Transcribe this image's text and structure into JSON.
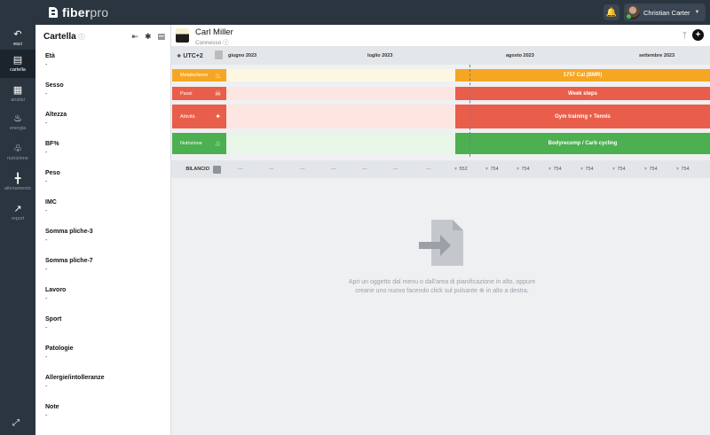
{
  "app": {
    "logo_main": "fiber",
    "logo_sub": "pro"
  },
  "user": {
    "name": "Christian Carter"
  },
  "nav": [
    {
      "label": "esci",
      "icon": "back-arrow-icon"
    },
    {
      "label": "cartella",
      "icon": "clipboard-icon"
    },
    {
      "label": "analisi",
      "icon": "chart-doc-icon"
    },
    {
      "label": "energia",
      "icon": "flame-icon"
    },
    {
      "label": "nutrizione",
      "icon": "cutlery-icon"
    },
    {
      "label": "allenamento",
      "icon": "dumbbell-icon"
    },
    {
      "label": "report",
      "icon": "line-chart-icon"
    }
  ],
  "panel": {
    "title": "Cartella",
    "fields": [
      {
        "label": "Età",
        "value": "-"
      },
      {
        "label": "Sesso",
        "value": "-"
      },
      {
        "label": "Altezza",
        "value": "-"
      },
      {
        "label": "BF%",
        "value": "-"
      },
      {
        "label": "Peso",
        "value": "-"
      },
      {
        "label": "IMC",
        "value": "-"
      },
      {
        "label": "Somma pliche-3",
        "value": "-"
      },
      {
        "label": "Somma pliche-7",
        "value": "-"
      },
      {
        "label": "Lavoro",
        "value": "-"
      },
      {
        "label": "Sport",
        "value": "-"
      },
      {
        "label": "Patologie",
        "value": "-"
      },
      {
        "label": "Allergie/intolleranze",
        "value": "-"
      },
      {
        "label": "Note",
        "value": "-"
      }
    ]
  },
  "patient": {
    "name": "Carl Miller",
    "status": "Connesso"
  },
  "timeline": {
    "timezone": "UTC+2",
    "months": [
      "giugno 2023",
      "luglio 2023",
      "agosto 2023",
      "settembre 2023"
    ],
    "rows": [
      {
        "label": "Metabolismo",
        "bar": "1757 Cal (BMR)",
        "color": "#f5a623",
        "light": "#fdf7e2"
      },
      {
        "label": "Passi",
        "bar": "Week steps",
        "color": "#e95e4a",
        "light": "#fde5e1"
      },
      {
        "label": "Attività",
        "bar": "Gym training + Tennis",
        "color": "#e95e4a",
        "light": "#fde5e1"
      },
      {
        "label": "Nutrizione",
        "bar": "Bodyrecomp / Carb cycling",
        "color": "#4caf50",
        "light": "#e8f6e8"
      }
    ],
    "bilancio": {
      "label": "BILANCIO",
      "empty": [
        "---",
        "---",
        "---",
        "---",
        "---",
        "---",
        "---"
      ],
      "values": [
        "552",
        "754",
        "754",
        "754",
        "754",
        "754",
        "754",
        "754"
      ]
    }
  },
  "empty_state": {
    "line1": "Apri un oggetto dal menu o dall'area di pianificazione in alto, oppure",
    "line2": "creane uno nuovo facendo click sul pulsante ⊕ in alto a destra."
  }
}
